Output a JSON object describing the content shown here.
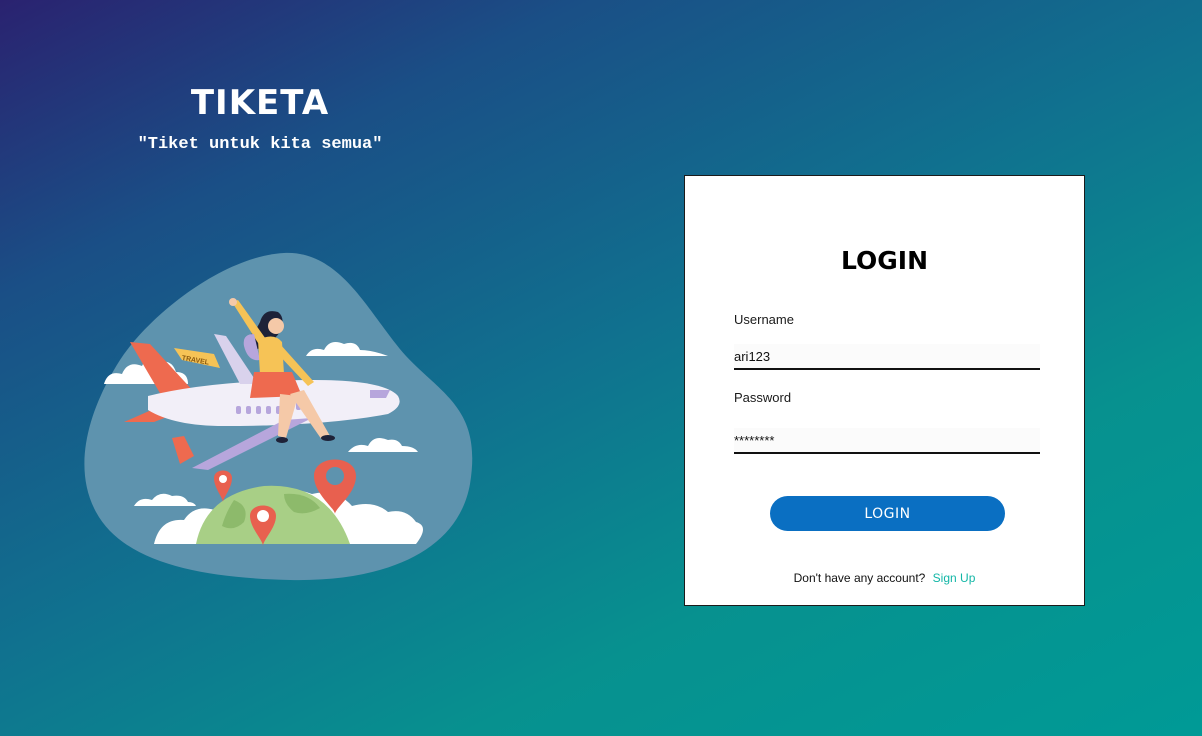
{
  "brand": {
    "title": "TIKETA",
    "tagline": "\"Tiket untuk kita semua\""
  },
  "illustration": {
    "banner_text": "TRAVEL",
    "colors": {
      "blob": "#5e93ae",
      "plane_body": "#f2eff8",
      "plane_accent": "#ee6a4f",
      "plane_wing": "#b7a6dc",
      "globe": "#a8cf86",
      "pin": "#e8604f",
      "cloud": "#ffffff"
    }
  },
  "login": {
    "heading": "LOGIN",
    "username_label": "Username",
    "username_value": "ari123",
    "password_label": "Password",
    "password_value": "********",
    "button_label": "LOGIN",
    "signup_prompt": "Don't have any account?",
    "signup_link": "Sign Up"
  },
  "colors": {
    "accent": "#0a6fc2",
    "link": "#12b6a6"
  }
}
